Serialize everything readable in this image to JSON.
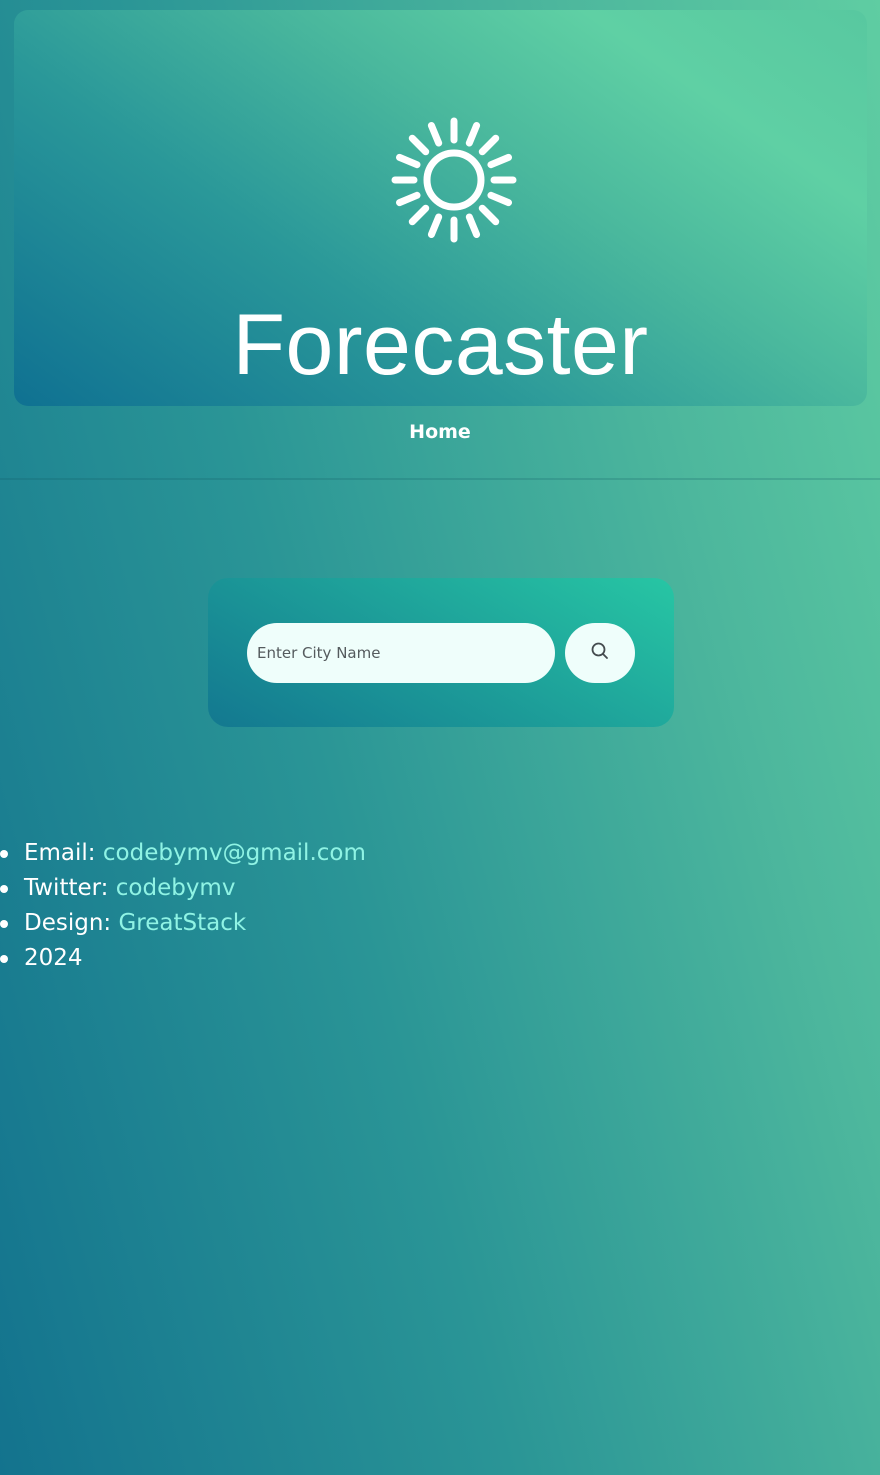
{
  "colors": {
    "background_start": "#13738e",
    "background_end": "#5fcda2",
    "link": "#8ff3e4",
    "input_background": "#effefb"
  },
  "header": {
    "logo_icon": "sun-icon",
    "title": "Forecaster"
  },
  "nav": {
    "home_label": "Home"
  },
  "search": {
    "placeholder": "Enter City Name",
    "value": "",
    "button_icon": "search-icon"
  },
  "footer": {
    "email_label": "Email:",
    "email_value": "codebymv@gmail.com",
    "twitter_label": "Twitter:",
    "twitter_value": "codebymv",
    "design_label": "Design:",
    "design_value": "GreatStack",
    "year": "2024"
  }
}
